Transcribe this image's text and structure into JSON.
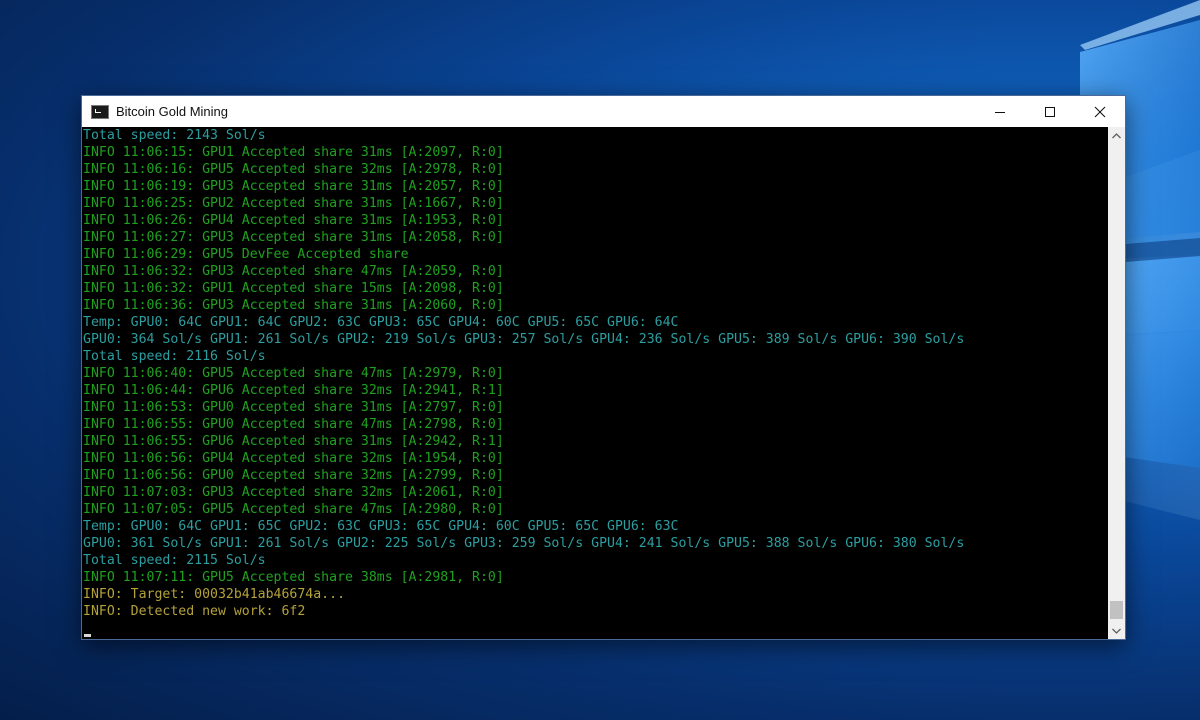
{
  "window": {
    "title": "Bitcoin Gold Mining"
  },
  "icons": {
    "app": "console-icon",
    "minimize": "minimize-icon",
    "maximize": "maximize-icon",
    "close": "close-icon",
    "scroll_up": "chevron-up-icon",
    "scroll_down": "chevron-down-icon"
  },
  "colors": {
    "info": "#1fa11f",
    "stat": "#2d9ea0",
    "warn": "#b4a23a"
  },
  "console": {
    "lines": [
      {
        "text": "Total speed: 2143 Sol/s",
        "type": "stat"
      },
      {
        "text": "INFO 11:06:15: GPU1 Accepted share 31ms [A:2097, R:0]",
        "type": "info"
      },
      {
        "text": "INFO 11:06:16: GPU5 Accepted share 32ms [A:2978, R:0]",
        "type": "info"
      },
      {
        "text": "INFO 11:06:19: GPU3 Accepted share 31ms [A:2057, R:0]",
        "type": "info"
      },
      {
        "text": "INFO 11:06:25: GPU2 Accepted share 31ms [A:1667, R:0]",
        "type": "info"
      },
      {
        "text": "INFO 11:06:26: GPU4 Accepted share 31ms [A:1953, R:0]",
        "type": "info"
      },
      {
        "text": "INFO 11:06:27: GPU3 Accepted share 31ms [A:2058, R:0]",
        "type": "info"
      },
      {
        "text": "INFO 11:06:29: GPU5 DevFee Accepted share",
        "type": "info"
      },
      {
        "text": "INFO 11:06:32: GPU3 Accepted share 47ms [A:2059, R:0]",
        "type": "info"
      },
      {
        "text": "INFO 11:06:32: GPU1 Accepted share 15ms [A:2098, R:0]",
        "type": "info"
      },
      {
        "text": "INFO 11:06:36: GPU3 Accepted share 31ms [A:2060, R:0]",
        "type": "info"
      },
      {
        "text": "Temp: GPU0: 64C GPU1: 64C GPU2: 63C GPU3: 65C GPU4: 60C GPU5: 65C GPU6: 64C",
        "type": "stat"
      },
      {
        "text": "GPU0: 364 Sol/s GPU1: 261 Sol/s GPU2: 219 Sol/s GPU3: 257 Sol/s GPU4: 236 Sol/s GPU5: 389 Sol/s GPU6: 390 Sol/s",
        "type": "stat"
      },
      {
        "text": "Total speed: 2116 Sol/s",
        "type": "stat"
      },
      {
        "text": "INFO 11:06:40: GPU5 Accepted share 47ms [A:2979, R:0]",
        "type": "info"
      },
      {
        "text": "INFO 11:06:44: GPU6 Accepted share 32ms [A:2941, R:1]",
        "type": "info"
      },
      {
        "text": "INFO 11:06:53: GPU0 Accepted share 31ms [A:2797, R:0]",
        "type": "info"
      },
      {
        "text": "INFO 11:06:55: GPU0 Accepted share 47ms [A:2798, R:0]",
        "type": "info"
      },
      {
        "text": "INFO 11:06:55: GPU6 Accepted share 31ms [A:2942, R:1]",
        "type": "info"
      },
      {
        "text": "INFO 11:06:56: GPU4 Accepted share 32ms [A:1954, R:0]",
        "type": "info"
      },
      {
        "text": "INFO 11:06:56: GPU0 Accepted share 32ms [A:2799, R:0]",
        "type": "info"
      },
      {
        "text": "INFO 11:07:03: GPU3 Accepted share 32ms [A:2061, R:0]",
        "type": "info"
      },
      {
        "text": "INFO 11:07:05: GPU5 Accepted share 47ms [A:2980, R:0]",
        "type": "info"
      },
      {
        "text": "Temp: GPU0: 64C GPU1: 65C GPU2: 63C GPU3: 65C GPU4: 60C GPU5: 65C GPU6: 63C",
        "type": "stat"
      },
      {
        "text": "GPU0: 361 Sol/s GPU1: 261 Sol/s GPU2: 225 Sol/s GPU3: 259 Sol/s GPU4: 241 Sol/s GPU5: 388 Sol/s GPU6: 380 Sol/s",
        "type": "stat"
      },
      {
        "text": "Total speed: 2115 Sol/s",
        "type": "stat"
      },
      {
        "text": "INFO 11:07:11: GPU5 Accepted share 38ms [A:2981, R:0]",
        "type": "info"
      },
      {
        "text": "INFO: Target: 00032b41ab46674a...",
        "type": "warn"
      },
      {
        "text": "INFO: Detected new work: 6f2",
        "type": "warn"
      }
    ]
  }
}
